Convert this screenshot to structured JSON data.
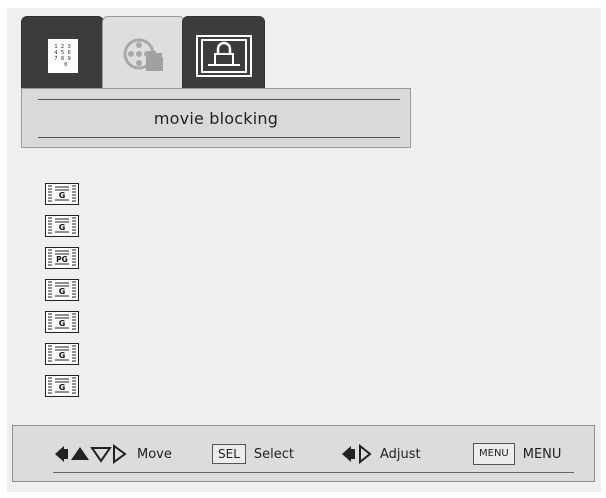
{
  "tabs": [
    {
      "icon": "keypad-icon",
      "selected": false
    },
    {
      "icon": "film-reel-icon",
      "selected": true
    },
    {
      "icon": "lock-icon",
      "selected": false
    }
  ],
  "keypad_digits": "1 2 3\n4 5 6\n7 8 9\n  0",
  "menu": {
    "title": "movie blocking"
  },
  "ratings": [
    {
      "label": "G"
    },
    {
      "label": "G"
    },
    {
      "label": "PG"
    },
    {
      "label": "G"
    },
    {
      "label": "G"
    },
    {
      "label": "G"
    },
    {
      "label": "G"
    }
  ],
  "footer": {
    "move_label": "Move",
    "select_key": "SEL",
    "select_label": "Select",
    "adjust_label": "Adjust",
    "menu_key": "MENU",
    "menu_label": "MENU"
  }
}
